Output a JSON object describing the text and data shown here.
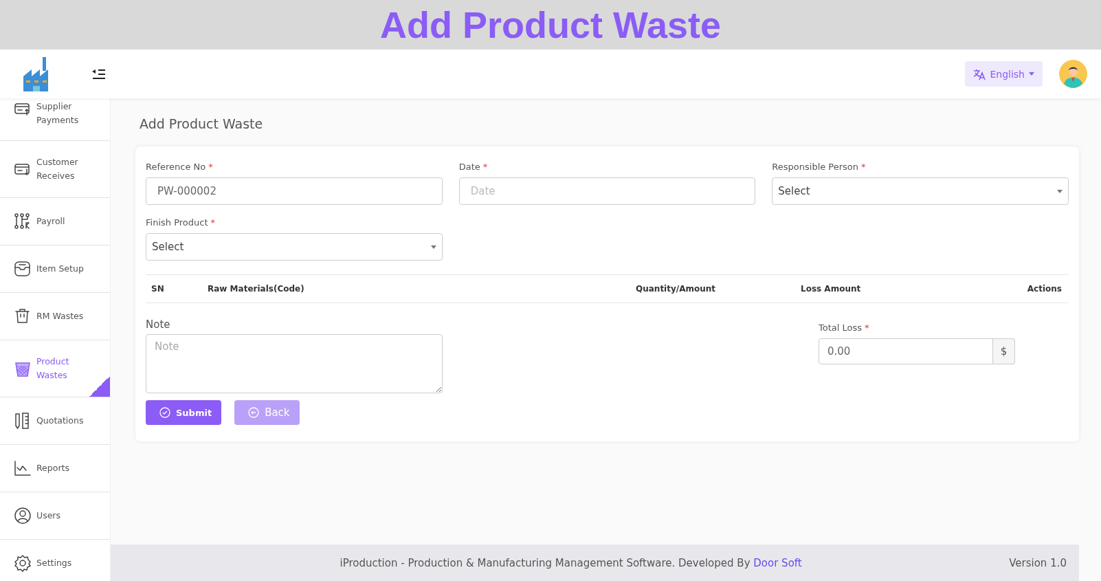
{
  "banner": {
    "title": "Add Product Waste"
  },
  "header": {
    "language": "English"
  },
  "sidebar": {
    "items": [
      {
        "label": "Supplier Payments",
        "selected": false
      },
      {
        "label": "Customer Receives",
        "selected": false
      },
      {
        "label": "Payroll",
        "selected": false
      },
      {
        "label": "Item Setup",
        "selected": false
      },
      {
        "label": "RM Wastes",
        "selected": false
      },
      {
        "label": "Product Wastes",
        "selected": true
      },
      {
        "label": "Quotations",
        "selected": false
      },
      {
        "label": "Reports",
        "selected": false
      },
      {
        "label": "Users",
        "selected": false
      },
      {
        "label": "Settings",
        "selected": false
      }
    ]
  },
  "page": {
    "title": "Add Product Waste"
  },
  "form": {
    "fields": [
      {
        "kind": "text",
        "label": "Reference No",
        "required_mark": "*",
        "value": "PW-000002"
      },
      {
        "kind": "text",
        "label": "Date",
        "required_mark": "*",
        "placeholder": "Date"
      },
      {
        "kind": "select",
        "label": "Responsible Person",
        "required_mark": "*",
        "value": "Select"
      },
      {
        "kind": "select",
        "label": "Finish Product",
        "required_mark": "*",
        "value": "Select"
      }
    ],
    "table": {
      "columns": [
        "SN",
        "Raw Materials(Code)",
        "Quantity/Amount",
        "Loss Amount",
        "Actions"
      ]
    },
    "note": {
      "label": "Note",
      "placeholder": "Note"
    },
    "total_loss": {
      "label": "Total Loss",
      "required_mark": "*",
      "value": "0.00",
      "unit": "$"
    },
    "buttons": [
      {
        "kind": "primary",
        "label": "Submit"
      },
      {
        "kind": "secondary",
        "label": "Back"
      }
    ]
  },
  "footer": {
    "text": "iProduction - Production & Manufacturing Management Software. Developed By",
    "link": "Door Soft",
    "version": "Version 1.0"
  }
}
